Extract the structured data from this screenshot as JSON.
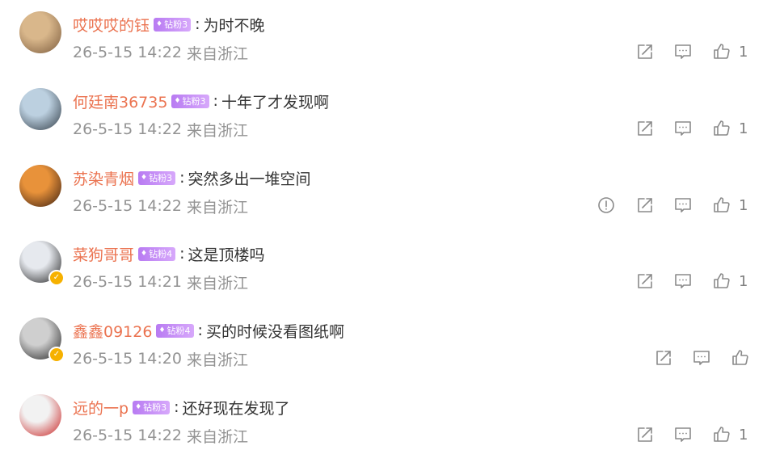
{
  "comments": [
    {
      "username": "哎哎哎的钰",
      "badge": "钻粉3",
      "text": "为时不晚",
      "date": "26-5-15 14:22",
      "location": "来自浙江",
      "likes": "1",
      "verified": false,
      "has_report": false,
      "avatar_colors": [
        "#d9b78b",
        "#7a5a3c"
      ]
    },
    {
      "username": "何廷南36735",
      "badge": "钻粉3",
      "text": "十年了才发现啊",
      "date": "26-5-15 14:22",
      "location": "来自浙江",
      "likes": "1",
      "verified": false,
      "has_report": false,
      "avatar_colors": [
        "#bcd0e0",
        "#2f3a44"
      ]
    },
    {
      "username": "苏染青烟",
      "badge": "钻粉3",
      "text": "突然多出一堆空间",
      "date": "26-5-15 14:22",
      "location": "来自浙江",
      "likes": "1",
      "verified": false,
      "has_report": true,
      "avatar_colors": [
        "#e8923a",
        "#3a1e10"
      ]
    },
    {
      "username": "菜狗哥哥",
      "badge": "钻粉4",
      "text": "这是顶楼吗",
      "date": "26-5-15 14:21",
      "location": "来自浙江",
      "likes": "1",
      "verified": true,
      "has_report": false,
      "avatar_colors": [
        "#e6e9ee",
        "#1e1e1e"
      ]
    },
    {
      "username": "鑫鑫09126",
      "badge": "钻粉4",
      "text": "买的时候没看图纸啊",
      "date": "26-5-15 14:20",
      "location": "来自浙江",
      "likes": "",
      "verified": true,
      "has_report": false,
      "avatar_colors": [
        "#cfcfcf",
        "#202020"
      ]
    },
    {
      "username": "远的一p",
      "badge": "钻粉3",
      "text": "还好现在发现了",
      "date": "26-5-15 14:22",
      "location": "来自浙江",
      "likes": "1",
      "verified": false,
      "has_report": false,
      "avatar_colors": [
        "#f2f2f2",
        "#c81e1e"
      ]
    }
  ],
  "icons": {
    "report": "report-icon",
    "share": "share-icon",
    "reply": "comment-icon",
    "like": "like-icon"
  },
  "colors": {
    "username": "#eb7350",
    "meta": "#939393",
    "text": "#333333",
    "badge": "#c48cf7",
    "verified": "#f6b100",
    "icon": "#8a8a8a"
  }
}
